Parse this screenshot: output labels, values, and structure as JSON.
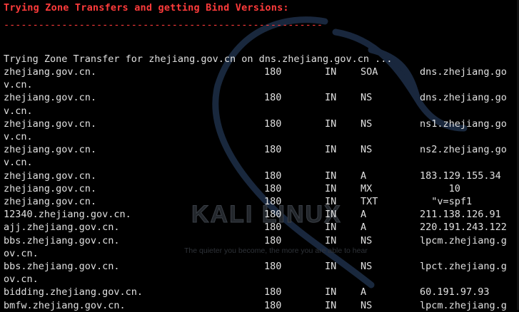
{
  "header": {
    "title": "Trying Zone Transfers and getting Bind Versions:",
    "rule": "-------------------------------------------------------"
  },
  "watermark": {
    "brand": "KALI LINUX",
    "tagline": "The quieter you become, the more you are able to hear"
  },
  "transfer_line": "Trying Zone Transfer for zhejiang.gov.cn on dns.zhejiang.gov.cn ...",
  "records": [
    {
      "name": "zhejiang.gov.cn.",
      "ttl": "180",
      "cls": "IN",
      "type": "SOA",
      "data": "dns.zhejiang.go",
      "wrap": "v.cn."
    },
    {
      "name": "zhejiang.gov.cn.",
      "ttl": "180",
      "cls": "IN",
      "type": "NS",
      "data": "dns.zhejiang.go",
      "wrap": "v.cn."
    },
    {
      "name": "zhejiang.gov.cn.",
      "ttl": "180",
      "cls": "IN",
      "type": "NS",
      "data": "ns1.zhejiang.go",
      "wrap": "v.cn."
    },
    {
      "name": "zhejiang.gov.cn.",
      "ttl": "180",
      "cls": "IN",
      "type": "NS",
      "data": "ns2.zhejiang.go",
      "wrap": "v.cn."
    },
    {
      "name": "zhejiang.gov.cn.",
      "ttl": "180",
      "cls": "IN",
      "type": "A",
      "data": "183.129.155.34"
    },
    {
      "name": "zhejiang.gov.cn.",
      "ttl": "180",
      "cls": "IN",
      "type": "MX",
      "data": "     10"
    },
    {
      "name": "zhejiang.gov.cn.",
      "ttl": "180",
      "cls": "IN",
      "type": "TXT",
      "data": "  \"v=spf1"
    },
    {
      "name": "12340.zhejiang.gov.cn.",
      "ttl": "180",
      "cls": "IN",
      "type": "A",
      "data": "211.138.126.91"
    },
    {
      "name": "ajj.zhejiang.gov.cn.",
      "ttl": "180",
      "cls": "IN",
      "type": "A",
      "data": "220.191.243.122"
    },
    {
      "name": "bbs.zhejiang.gov.cn.",
      "ttl": "180",
      "cls": "IN",
      "type": "NS",
      "data": "lpcm.zhejiang.g",
      "wrap": "ov.cn."
    },
    {
      "name": "bbs.zhejiang.gov.cn.",
      "ttl": "180",
      "cls": "IN",
      "type": "NS",
      "data": "lpct.zhejiang.g",
      "wrap": "ov.cn."
    },
    {
      "name": "bidding.zhejiang.gov.cn.",
      "ttl": "180",
      "cls": "IN",
      "type": "A",
      "data": "60.191.97.93"
    },
    {
      "name": "bmfw.zhejiang.gov.cn.",
      "ttl": "180",
      "cls": "IN",
      "type": "NS",
      "data": "lpcm.zhejiang.g"
    }
  ]
}
